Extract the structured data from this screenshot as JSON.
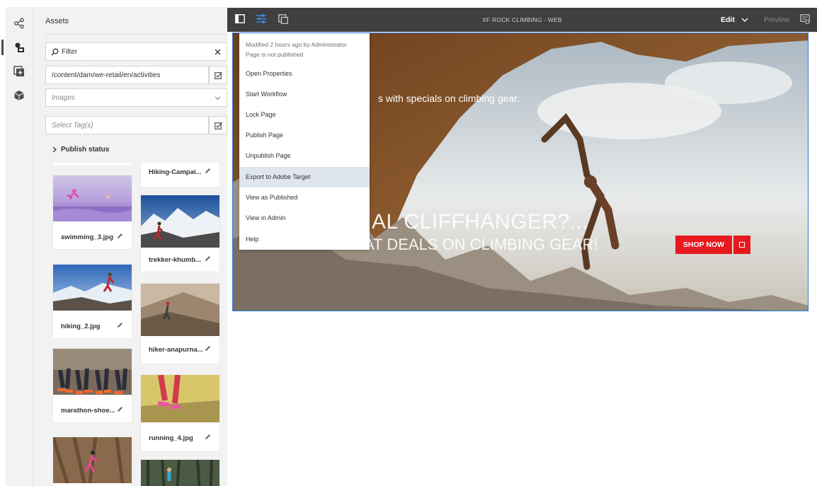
{
  "rail": {
    "items": [
      {
        "icon": "share-icon"
      },
      {
        "icon": "assets-icon"
      },
      {
        "icon": "components-icon"
      },
      {
        "icon": "content-fragments-icon"
      }
    ]
  },
  "panel": {
    "title": "Assets",
    "filter_placeholder": "Filter",
    "path_value": "/content/dam/we-retail/en/activities",
    "type_select": "Images",
    "tags_placeholder": "Select Tag(s)",
    "publish_status": "Publish status",
    "assets": [
      {
        "name": "Hiking-Campai..."
      },
      {
        "name": "swimming_3.jpg"
      },
      {
        "name": "trekker-khumb..."
      },
      {
        "name": "hiking_2.jpg"
      },
      {
        "name": "hiker-anapurna..."
      },
      {
        "name": "marathon-shoe..."
      },
      {
        "name": "running_4.jpg"
      }
    ]
  },
  "toolbar": {
    "title": "XF ROCK CLIMBING - WEB",
    "edit_label": "Edit",
    "preview_label": "Preview"
  },
  "hero": {
    "subtitle": "s with specials on climbing gear.",
    "headline": "AL CLIFFHANGER?...",
    "subheadline": "THESE GREAT DEALS ON CLIMBING GEAR!",
    "cta_label": "SHOP NOW"
  },
  "menu": {
    "modified": "Modified 2 hours ago by Administrator",
    "status": "Page is not published",
    "items": [
      {
        "label": "Open Properties"
      },
      {
        "label": "Start Workflow"
      },
      {
        "label": "Lock Page"
      },
      {
        "label": "Publish Page"
      },
      {
        "label": "Unpublish Page"
      },
      {
        "label": "Export to Adobe Target",
        "highlighted": true
      },
      {
        "label": "View as Published"
      },
      {
        "label": "View in Admin"
      },
      {
        "label": "Help"
      }
    ]
  },
  "colors": {
    "accent": "#2c7be5",
    "cta": "#e8191e",
    "toolbar": "#3f3f3f"
  }
}
